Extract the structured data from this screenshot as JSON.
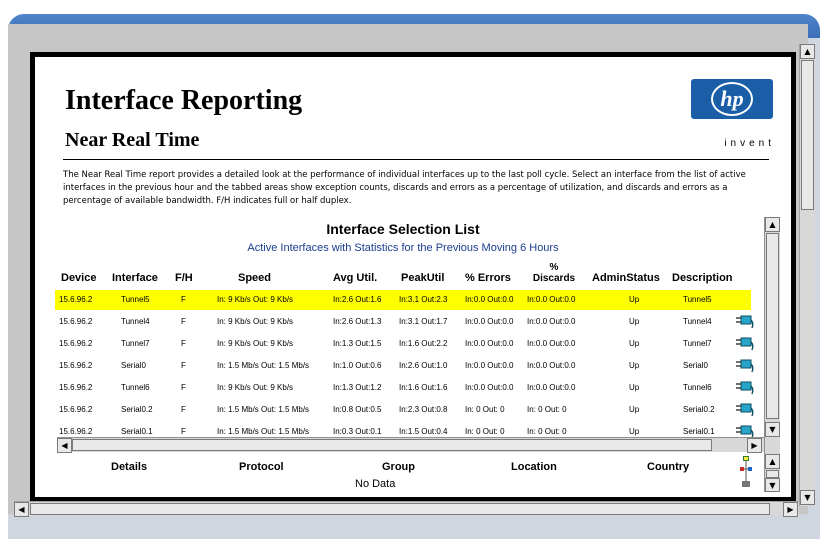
{
  "report": {
    "title": "Interface Reporting",
    "subtitle": "Near Real Time",
    "logo_text": "hp",
    "logo_tagline": "invent",
    "description": "The Near Real Time report provides a detailed look at the performance of individual interfaces up to the last poll cycle. Select an interface from the list of active interfaces in the previous hour and the tabbed areas show exception counts, discards and errors as a percentage of utilization, and discards and errors as a percentage of available bandwidth. F/H indicates full or half duplex."
  },
  "selection": {
    "title": "Interface Selection List",
    "subtitle": "Active Interfaces with Statistics for the Previous Moving 6 Hours",
    "headers": {
      "device": "Device",
      "interface": "Interface",
      "fh": "F/H",
      "speed": "Speed",
      "avg": "Avg Util.",
      "peak": "PeakUtil",
      "errors": "% Errors",
      "discards_pct": "%",
      "discards": "Discards",
      "admin": "AdminStatus",
      "desc": "Description"
    },
    "rows": [
      {
        "device": "15.6.96.2",
        "iface": "Tunnel5",
        "fh": "F",
        "speed": "In: 9 Kb/s Out: 9 Kb/s",
        "avg": "In:2.6 Out:1.6",
        "peak": "In:3.1 Out:2.3",
        "errors": "In:0.0 Out:0.0",
        "discards": "In:0.0 Out:0.0",
        "admin": "Up",
        "desc": "Tunnel5"
      },
      {
        "device": "15.6.96.2",
        "iface": "Tunnel4",
        "fh": "F",
        "speed": "In: 9 Kb/s Out: 9 Kb/s",
        "avg": "In:2.6 Out:1.3",
        "peak": "In:3.1 Out:1.7",
        "errors": "In:0.0 Out:0.0",
        "discards": "In:0.0 Out:0.0",
        "admin": "Up",
        "desc": "Tunnel4"
      },
      {
        "device": "15.6.96.2",
        "iface": "Tunnel7",
        "fh": "F",
        "speed": "In: 9 Kb/s Out: 9 Kb/s",
        "avg": "In:1.3 Out:1.5",
        "peak": "In:1.6 Out:2.2",
        "errors": "In:0.0 Out:0.0",
        "discards": "In:0.0 Out:0.0",
        "admin": "Up",
        "desc": "Tunnel7"
      },
      {
        "device": "15.6.96.2",
        "iface": "Serial0",
        "fh": "F",
        "speed": "In: 1.5 Mb/s Out: 1.5 Mb/s",
        "avg": "In:1.0 Out:0.6",
        "peak": "In:2.6 Out:1.0",
        "errors": "In:0.0 Out:0.0",
        "discards": "In:0.0 Out:0.0",
        "admin": "Up",
        "desc": "Serial0"
      },
      {
        "device": "15.6.96.2",
        "iface": "Tunnel6",
        "fh": "F",
        "speed": "In: 9 Kb/s Out: 9 Kb/s",
        "avg": "In:1.3 Out:1.2",
        "peak": "In:1.6 Out:1.6",
        "errors": "In:0.0 Out:0.0",
        "discards": "In:0.0 Out:0.0",
        "admin": "Up",
        "desc": "Tunnel6"
      },
      {
        "device": "15.6.96.2",
        "iface": "Serial0.2",
        "fh": "F",
        "speed": "In: 1.5 Mb/s Out: 1.5 Mb/s",
        "avg": "In:0.8 Out:0.5",
        "peak": "In:2.3 Out:0.8",
        "errors": "In: 0 Out: 0",
        "discards": "In: 0 Out: 0",
        "admin": "Up",
        "desc": "Serial0.2"
      },
      {
        "device": "15.6.96.2",
        "iface": "Serial0.1",
        "fh": "F",
        "speed": "In: 1.5 Mb/s Out: 1.5 Mb/s",
        "avg": "In:0.3 Out:0.1",
        "peak": "In:1.5 Out:0.4",
        "errors": "In: 0 Out: 0",
        "discards": "In: 0 Out: 0",
        "admin": "Up",
        "desc": "Serial0.1"
      }
    ]
  },
  "details": {
    "headers": {
      "details": "Details",
      "protocol": "Protocol",
      "group": "Group",
      "location": "Location",
      "country": "Country"
    },
    "empty_text": "No Data"
  },
  "colors": {
    "highlight_row": "#ffff00",
    "subtitle_text": "#1a3d8f",
    "window_titlebar": "#3a6fb7",
    "logo_bg": "#1a5ea8"
  },
  "icons": {
    "row_action": "network-plug-icon",
    "details": "tree-network-icon"
  }
}
